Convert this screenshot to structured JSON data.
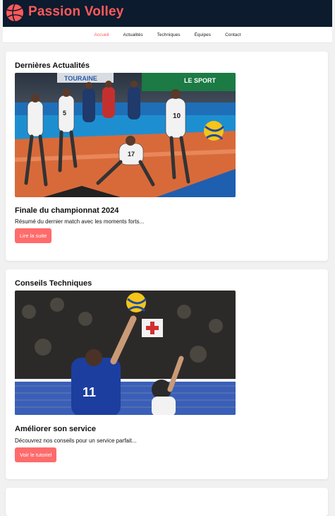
{
  "brand": {
    "name": "Passion Volley",
    "logo_icon": "volleyball-icon",
    "accent": "#ff5a5a",
    "header_bg": "#0c1b2e"
  },
  "nav": {
    "items": [
      {
        "label": "Accueil",
        "active": true
      },
      {
        "label": "Actualités",
        "active": false
      },
      {
        "label": "Techniques",
        "active": false
      },
      {
        "label": "Équipes",
        "active": false
      },
      {
        "label": "Contact",
        "active": false
      }
    ]
  },
  "sections": [
    {
      "heading": "Dernières Actualités",
      "image_banner": "LE SPORT",
      "image_subbanner": "TOURAINE",
      "article_title": "Finale du championnat 2024",
      "article_text": "Résumé du dernier match avec les moments forts...",
      "button_label": "Lire la suite"
    },
    {
      "heading": "Conseils Techniques",
      "image_jersey": "11",
      "article_title": "Améliorer son service",
      "article_text": "Découvrez nos conseils pour un service parfait...",
      "button_label": "Voir le tutoriel"
    }
  ]
}
